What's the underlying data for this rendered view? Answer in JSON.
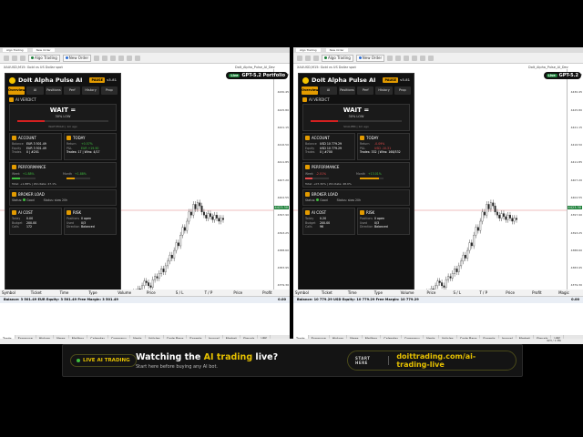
{
  "window_tabs": {
    "left": [
      "Algo Trading",
      "New Order"
    ],
    "right": [
      "Algo Trading",
      "New Order"
    ]
  },
  "chart": {
    "header_left": "XAUUSD,M15: Gold vs US Dollar spot",
    "header_right": "XAUUSD,M15: Gold vs US Dollar spot",
    "tag_left": "DoIt_Alpha_Pulse_AI_Dev",
    "tag_right": "DoIt_Alpha_Pulse_AI_Dev",
    "badge_live": "Live",
    "badge_left": "GPT-5.2 Portfolio",
    "badge_right": "GPT-5.2",
    "price_ticks": [
      "4435.10",
      "4430.45",
      "4425.80",
      "4421.15",
      "4416.50",
      "4411.85",
      "4407.20",
      "4402.55",
      "4397.90",
      "4393.25",
      "4388.60",
      "4383.95",
      "4379.30",
      "4374.65",
      "4370.00"
    ],
    "last_price": "4423.30",
    "time_ticks": [
      "11 Aug 2025",
      "11 Aug 20:00",
      "12 Aug 02:00",
      "12 Aug 08:00",
      "12 Aug 14:00",
      "12 Aug 20:00",
      "13 Aug 02:00",
      "13 Aug 08:00",
      "13 Aug 14:00",
      "13 Aug 20:00",
      "14 Aug 02:00",
      "14 Aug 08:00",
      "14 Aug 14:00"
    ],
    "symbol_tabs": [
      "XAUUSD,M15",
      "USDJPY,H1",
      "GBPJPY,H1",
      "GBPUSD,H1",
      "NZDUSD,H1",
      "SEN,H1"
    ],
    "chart_series": [
      12,
      14,
      13,
      16,
      15,
      18,
      17,
      20,
      19,
      22,
      25,
      24,
      22,
      21,
      26,
      28,
      27,
      30,
      33,
      31,
      35,
      38,
      42,
      40,
      45,
      50,
      48,
      55,
      60,
      58,
      64,
      70,
      68,
      75,
      72,
      76,
      74,
      70,
      68,
      66,
      69,
      67,
      65,
      68,
      66,
      64,
      66,
      65
    ]
  },
  "panels": [
    {
      "title": "DoIt Alpha Pulse AI",
      "status": "PAUSE",
      "version": "v3.81",
      "tabs": [
        "Overview",
        "AI",
        "Positions",
        "Perf",
        "History",
        "Prop"
      ],
      "ai_verdict_label": "AI VERDICT",
      "verdict": "WAIT =",
      "confidence": "30% LOW",
      "verdict_level": 0.3,
      "verdict_sub": "WAIT/HOLD | 1m ago",
      "account": {
        "label": "ACCOUNT",
        "rows": [
          [
            "Balance",
            "EUR 3 501.49"
          ],
          [
            "Equity",
            "EUR 3 501.49"
          ],
          [
            "Trades",
            "0 | #201"
          ]
        ]
      },
      "today": {
        "label": "TODAY",
        "rows": [
          [
            "Return",
            "+0.57%"
          ],
          [
            "P&L",
            "EUR +19.90"
          ],
          [
            "",
            "Trades: 17 | Wins: 4/17"
          ]
        ]
      },
      "performance": {
        "label": "PERFORMANCE",
        "week_label": "Week",
        "week": "+1.88%",
        "month_label": "Month",
        "month": "+1.88%",
        "week_level": 0.35,
        "month_level": 0.35,
        "footer": "Total: +1.88% | Win Rate: 47.1%"
      },
      "broker": {
        "label": "BROKER LOAD",
        "status_label": "Status:",
        "status": "Good",
        "note": "Status: slow 20h"
      },
      "ai_cost": {
        "label": "AI COST",
        "rows": [
          [
            "Today",
            "0.00"
          ],
          [
            "Budget",
            "200.00"
          ],
          [
            "Calls",
            "172"
          ]
        ]
      },
      "risk": {
        "label": "RISK",
        "rows": [
          [
            "Positions",
            "0 open"
          ],
          [
            "Used",
            "0/3"
          ],
          [
            "Direction",
            "Balanced"
          ]
        ]
      }
    },
    {
      "title": "DoIt Alpha Pulse AI",
      "status": "PAUSE",
      "version": "v3.81",
      "tabs": [
        "Overview",
        "AI",
        "Positions",
        "Perf",
        "History",
        "Prop"
      ],
      "ai_verdict_label": "AI VERDICT",
      "verdict": "WAIT =",
      "confidence": "30% LOW",
      "verdict_level": 0.3,
      "verdict_sub": "SCALPER | 1m ago",
      "account": {
        "label": "ACCOUNT",
        "rows": [
          [
            "Balance",
            "USD 10 779.29"
          ],
          [
            "Equity",
            "USD 10 779.29"
          ],
          [
            "Trades",
            "0 | #700"
          ]
        ]
      },
      "today": {
        "label": "TODAY",
        "rows": [
          [
            "Return",
            "-0.09%"
          ],
          [
            "P&L",
            "USD -10.31"
          ],
          [
            "",
            "Trades: 332 | Wins: 168/332"
          ]
        ]
      },
      "performance": {
        "label": "PERFORMANCE",
        "week_label": "Week",
        "week": "-2.01%",
        "month_label": "Month",
        "month": "+13.01%",
        "week_level": 0.3,
        "month_level": 0.8,
        "footer": "Total: +07.30% | Win Rate: 48.0%"
      },
      "broker": {
        "label": "BROKER LOAD",
        "status_label": "Status:",
        "status": "Good",
        "note": "Status: slow 20h"
      },
      "ai_cost": {
        "label": "AI COST",
        "rows": [
          [
            "Today",
            "0.20"
          ],
          [
            "Budget",
            "200.00"
          ],
          [
            "Calls",
            "96"
          ]
        ]
      },
      "risk": {
        "label": "RISK",
        "rows": [
          [
            "Positions",
            "0 open"
          ],
          [
            "Used",
            "0/3"
          ],
          [
            "Direction",
            "Balanced"
          ]
        ]
      }
    }
  ],
  "terminal": {
    "columns": [
      "Symbol",
      "Ticket",
      "Time",
      "Type",
      "Volume",
      "Price",
      "S / L",
      "T / P",
      "Price",
      "Profit"
    ],
    "left_balance": "Balance: 3 501.49 EUR  Equity: 3 501.49  Free Margin: 3 501.49",
    "right_balance": "Balance: 10 779.29 USD  Equity: 10 779.29  Free Margin: 10 779.29",
    "left_total": "0.00",
    "right_total": "0.00",
    "right_extra_col": "Magic",
    "tabs": [
      "Trade",
      "Exposure",
      "History",
      "News",
      "Mailbox",
      "Calendar",
      "Company",
      "Alerts",
      "Articles",
      "Code Base",
      "Experts",
      "Journal",
      "Market",
      "Signals",
      "VPS"
    ]
  },
  "statusbar": "423 / 1 Mb",
  "banner": {
    "live_pill": "LIVE AI TRADING",
    "headline_pre": "Watching the ",
    "headline_hl": "AI trading",
    "headline_post": " live?",
    "sub": "Start here before buying any AI bot.",
    "cta_label": "START HERE",
    "cta_url": "doittrading.com/ai-trading-live",
    "accent": "#e6c100"
  }
}
